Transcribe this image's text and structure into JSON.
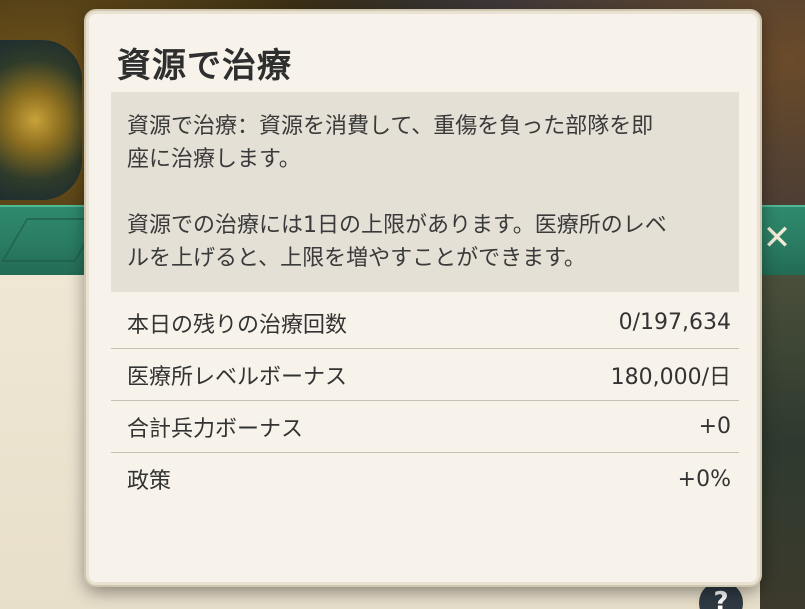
{
  "tooltip": {
    "title": "資源で治療",
    "description": [
      "資源で治療：資源を消費して、重傷を負った部隊を即\n座に治療します。",
      "資源での治療には1日の上限があります。医療所のレベ\nルを上げると、上限を増やすことができます。"
    ],
    "stats": [
      {
        "label": "本日の残りの治療回数",
        "value": "0/197,634"
      },
      {
        "label": "医療所レベルボーナス",
        "value": "180,000/日"
      },
      {
        "label": "合計兵力ボーナス",
        "value": "+0"
      },
      {
        "label": "政策",
        "value": "+0%"
      }
    ]
  },
  "background": {
    "close_glyph": "✕",
    "help_glyph": "?",
    "icons": [
      "close-icon",
      "help-icon",
      "banner-ornament"
    ]
  },
  "colors": {
    "panel": "#f7f3ea",
    "desc_box": "#e5e0d6",
    "banner": "#2a7d63",
    "text": "#333333"
  }
}
